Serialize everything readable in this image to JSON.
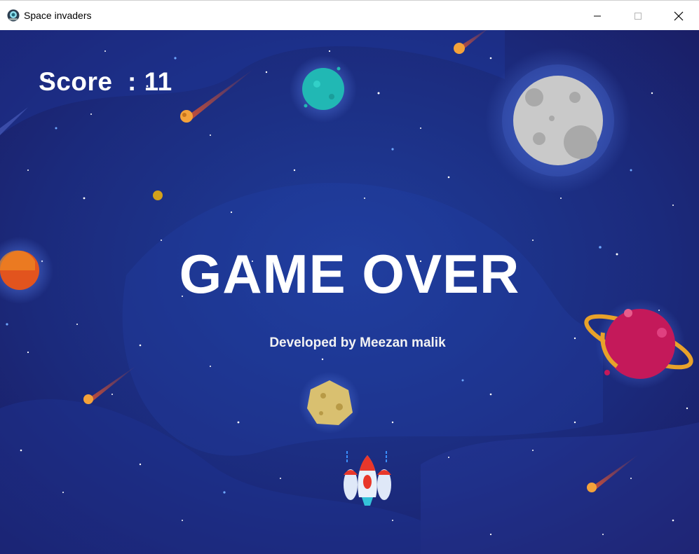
{
  "window": {
    "title": "Space invaders",
    "app_icon": "alien-icon",
    "controls": [
      "minimize-icon",
      "maximize-icon",
      "close-icon"
    ]
  },
  "hud": {
    "score_label": "Score",
    "score_value": 11
  },
  "screen": {
    "headline": "GAME OVER",
    "credit": "Developed by Meezan malik"
  },
  "colors": {
    "space_background": "#1b2a7c",
    "text": "#ffffff",
    "player_ship": "#e8372a"
  }
}
